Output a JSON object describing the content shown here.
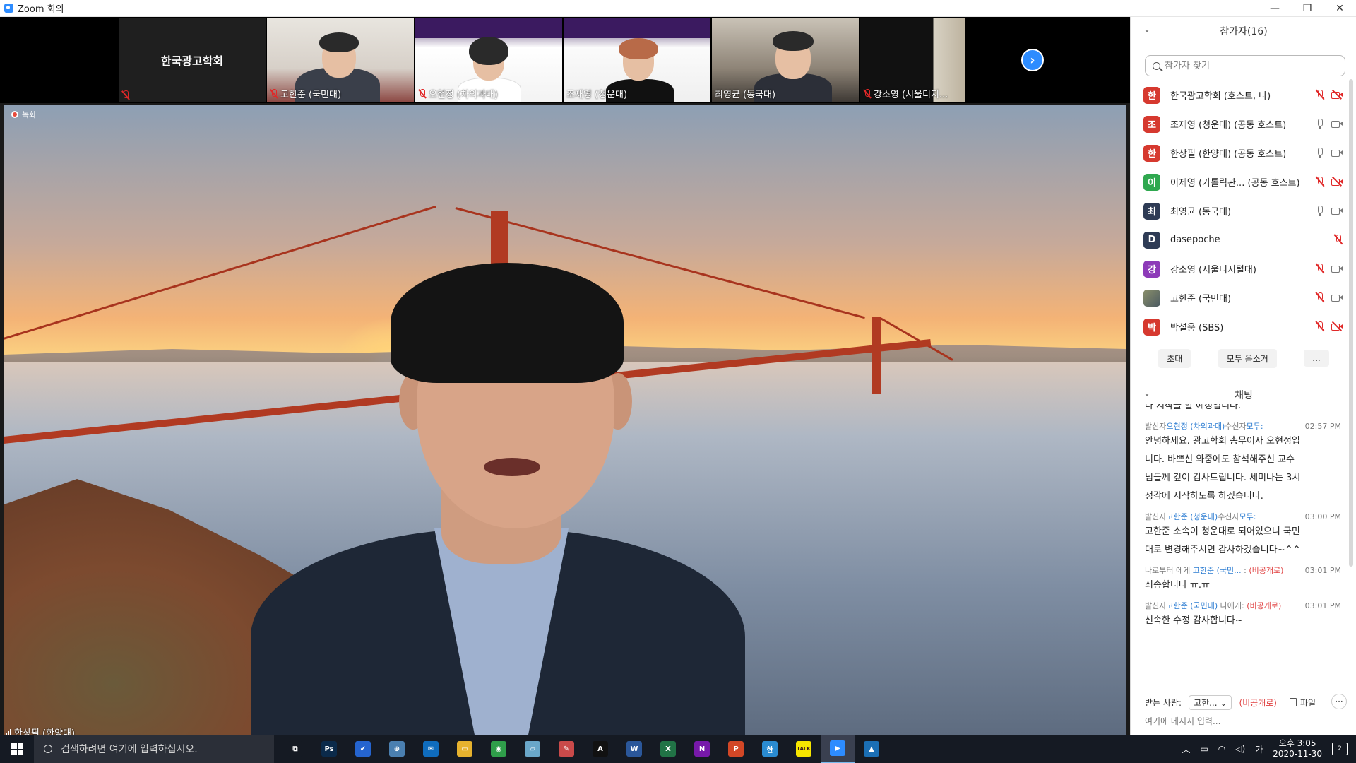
{
  "window": {
    "title": "Zoom 회의",
    "minimize": "—",
    "maximize": "❐",
    "close": "✕"
  },
  "strip": {
    "host_tile_label": "한국광고학회",
    "tiles": [
      {
        "name": "고한준 (국민대)",
        "muted": true
      },
      {
        "name": "오현정 (차의과대)",
        "muted": true
      },
      {
        "name": "조재영 (청운대)",
        "muted": false
      },
      {
        "name": "최영균 (동국대)",
        "muted": false
      },
      {
        "name": "강소영 (서울디지...",
        "muted": true
      }
    ],
    "next_arrow": "›"
  },
  "recording": {
    "label": "녹화"
  },
  "main_speaker": {
    "name": "한상필 (한양대)"
  },
  "participants": {
    "title": "참가자(16)",
    "search_placeholder": "참가자 찾기",
    "list": [
      {
        "initial": "한",
        "name": "한국광고학회 (호스트, 나)",
        "color": "#d6392f",
        "mic": "off",
        "cam": "off"
      },
      {
        "initial": "조",
        "name": "조재영 (청운대) (공동 호스트)",
        "color": "#d6392f",
        "mic": "on",
        "cam": "on"
      },
      {
        "initial": "한",
        "name": "한상필 (한양대) (공동 호스트)",
        "color": "#d6392f",
        "mic": "on",
        "cam": "on"
      },
      {
        "initial": "이",
        "name": "이제영 (가톨릭관...  (공동 호스트)",
        "color": "#2fa84f",
        "mic": "off",
        "cam": "off"
      },
      {
        "initial": "최",
        "name": "최영균 (동국대)",
        "color": "#2e3b55",
        "mic": "on",
        "cam": "on"
      },
      {
        "initial": "D",
        "name": "dasepoche",
        "color": "#2e3b55",
        "mic": "off",
        "cam": "none"
      },
      {
        "initial": "강",
        "name": "강소영 (서울디지털대)",
        "color": "#8d3ab8",
        "mic": "off",
        "cam": "on"
      },
      {
        "initial": "",
        "name": "고한준 (국민대)",
        "color": "#6b6b58",
        "mic": "off",
        "cam": "on"
      },
      {
        "initial": "박",
        "name": "박설웅 (SBS)",
        "color": "#d6392f",
        "mic": "off",
        "cam": "off"
      }
    ],
    "buttons": {
      "invite": "초대",
      "mute_all": "모두 음소거",
      "more": "..."
    }
  },
  "chat": {
    "title": "채팅",
    "cut_text": "나 시작을 할 예정입니다.",
    "messages": [
      {
        "from_label": "발신자",
        "from": "오현정 (차의과대)",
        "to_label": "수신자",
        "to": "모두:",
        "private": "",
        "time": "02:57 PM",
        "lines": [
          "안녕하세요. 광고학회 총무이사 오현정입",
          "니다. 바쁘신 와중에도 참석해주신 교수",
          "님들께 깊이 감사드립니다.  세미나는 3시",
          "정각에 시작하도록 하겠습니다."
        ]
      },
      {
        "from_label": "발신자",
        "from": "고한준 (청운대)",
        "to_label": "수신자",
        "to": "모두:",
        "private": "",
        "time": "03:00 PM",
        "lines": [
          "고한준 소속이 청운대로 되어있으니 국민",
          "대로 변경해주시면 감사하겠습니다~^^"
        ]
      },
      {
        "from_label": "나로부터 에게 ",
        "from": "고한준 (국민...",
        "to_label": " : ",
        "to": "",
        "private": "(비공개로)",
        "time": "03:01 PM",
        "lines": [
          "죄송합니다 ㅠ.ㅠ"
        ]
      },
      {
        "from_label": "발신자",
        "from": "고한준 (국민대)",
        "to_label": " 나에게: ",
        "to": "",
        "private": "(비공개로)",
        "time": "03:01 PM",
        "lines": [
          "신속한 수정 감사합니다~"
        ]
      }
    ],
    "footer": {
      "recipient_label": "받는 사람:",
      "recipient_value": "고한...",
      "private": "(비공개로)",
      "file": "파일",
      "more": "···",
      "input_placeholder": "여기에 메시지 입력..."
    }
  },
  "taskbar": {
    "search_placeholder": "검색하려면 여기에 입력하십시오.",
    "apps": [
      {
        "name": "task-view",
        "label": "⧉",
        "color": "#151a23"
      },
      {
        "name": "photoshop",
        "label": "Ps",
        "color": "#0b2a4a"
      },
      {
        "name": "todo",
        "label": "✔",
        "color": "#2564cf"
      },
      {
        "name": "vpn",
        "label": "⊕",
        "color": "#4a7fb0"
      },
      {
        "name": "mail",
        "label": "✉",
        "color": "#0f6cbd"
      },
      {
        "name": "explorer",
        "label": "▭",
        "color": "#e6b22e"
      },
      {
        "name": "chrome",
        "label": "◉",
        "color": "#2f9e4a"
      },
      {
        "name": "notes",
        "label": "▱",
        "color": "#6aa7c9"
      },
      {
        "name": "paint",
        "label": "✎",
        "color": "#c94a4a"
      },
      {
        "name": "acrobat",
        "label": "A",
        "color": "#111111"
      },
      {
        "name": "word",
        "label": "W",
        "color": "#2b579a"
      },
      {
        "name": "excel",
        "label": "X",
        "color": "#217346"
      },
      {
        "name": "onenote",
        "label": "N",
        "color": "#7719aa"
      },
      {
        "name": "powerpoint",
        "label": "P",
        "color": "#d24726"
      },
      {
        "name": "hwp",
        "label": "한",
        "color": "#2a8bd1"
      },
      {
        "name": "kakaotalk",
        "label": "TALK",
        "color": "#f7e600"
      },
      {
        "name": "zoom",
        "label": "▶",
        "color": "#2D8CFF"
      },
      {
        "name": "photos",
        "label": "▲",
        "color": "#1b6fb5"
      }
    ],
    "ime": "가",
    "time": "오후 3:05",
    "date": "2020-11-30",
    "notifications": "2"
  }
}
